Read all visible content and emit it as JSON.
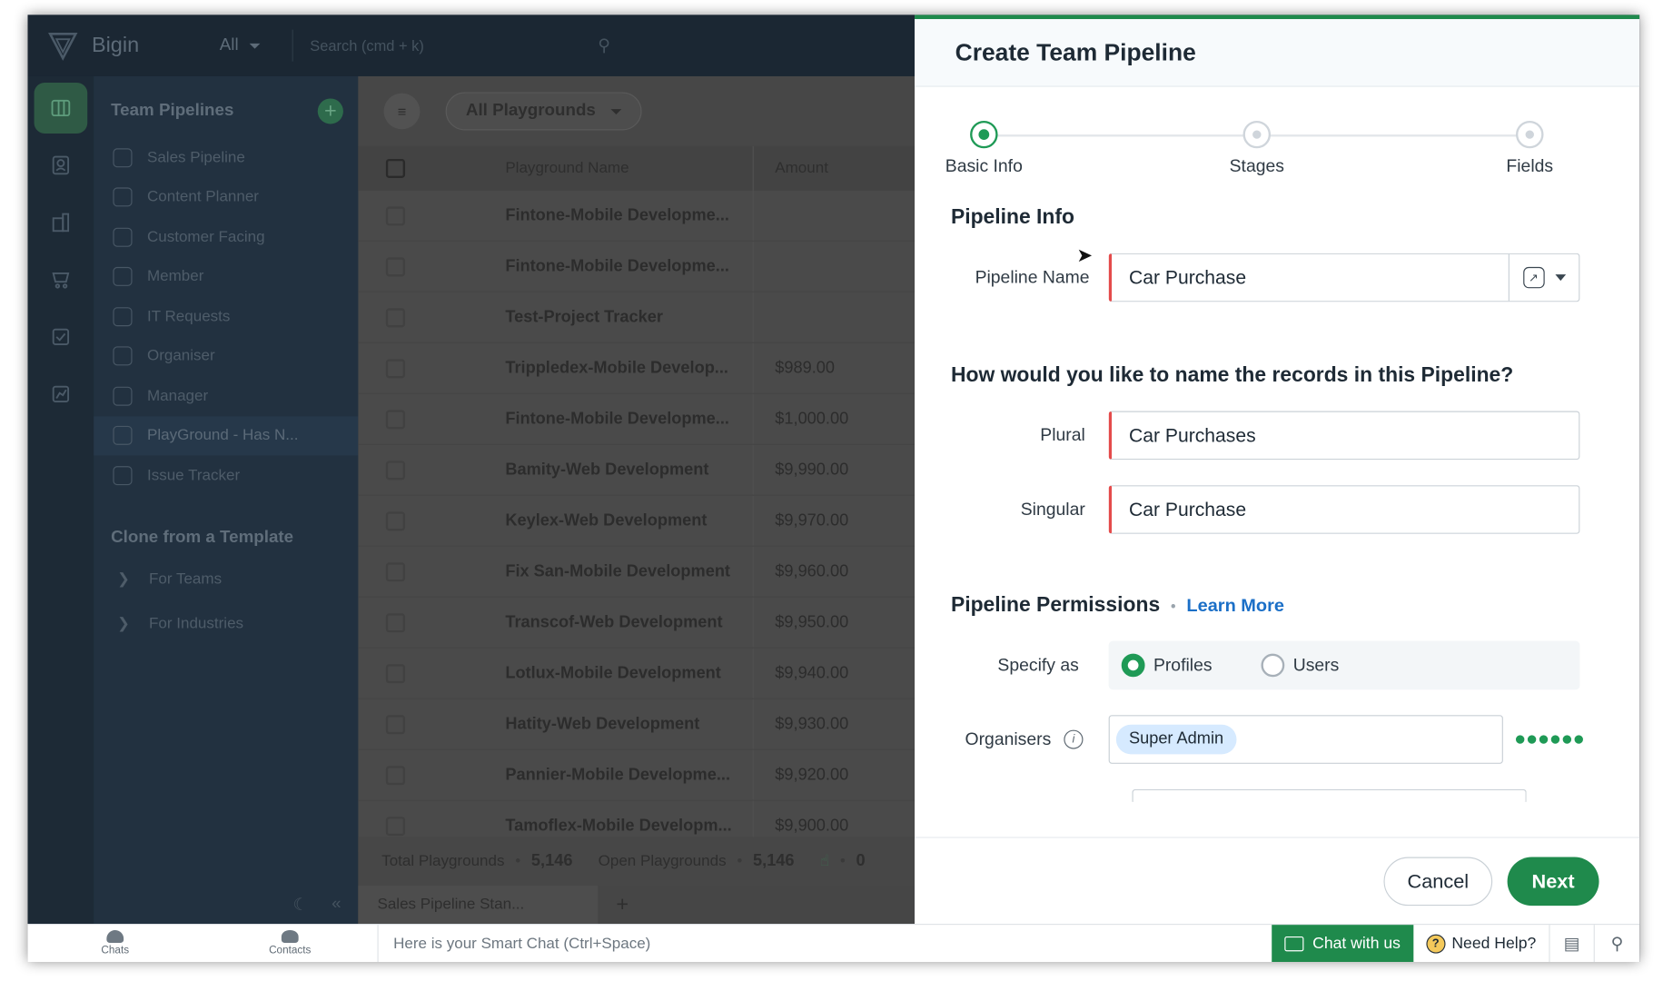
{
  "app": {
    "name": "Bigin"
  },
  "topbar": {
    "filter_label": "All",
    "search_placeholder": "Search (cmd + k)"
  },
  "rail": {
    "icons": [
      "pipeline-icon",
      "contacts-icon",
      "companies-icon",
      "products-icon",
      "tasks-icon",
      "reports-icon"
    ]
  },
  "sidebar": {
    "section_title": "Team Pipelines",
    "items": [
      {
        "label": "Sales Pipeline"
      },
      {
        "label": "Content Planner"
      },
      {
        "label": "Customer Facing"
      },
      {
        "label": "Member"
      },
      {
        "label": "IT Requests"
      },
      {
        "label": "Organiser"
      },
      {
        "label": "Manager"
      },
      {
        "label": "PlayGround - Has N..."
      },
      {
        "label": "Issue Tracker"
      }
    ],
    "clone_title": "Clone from a Template",
    "clone_items": [
      {
        "label": "For Teams"
      },
      {
        "label": "For Industries"
      }
    ]
  },
  "main": {
    "select_label": "All Playgrounds",
    "columns": {
      "name": "Playground Name",
      "amount": "Amount"
    },
    "rows": [
      {
        "name": "Fintone-Mobile Developme...",
        "amount": ""
      },
      {
        "name": "Fintone-Mobile Developme...",
        "amount": ""
      },
      {
        "name": "Test-Project Tracker",
        "amount": ""
      },
      {
        "name": "Trippledex-Mobile Develop...",
        "amount": "$989.00"
      },
      {
        "name": "Fintone-Mobile Developme...",
        "amount": "$1,000.00"
      },
      {
        "name": "Bamity-Web Development",
        "amount": "$9,990.00"
      },
      {
        "name": "Keylex-Web Development",
        "amount": "$9,970.00"
      },
      {
        "name": "Fix San-Mobile Development",
        "amount": "$9,960.00"
      },
      {
        "name": "Transcof-Web Development",
        "amount": "$9,950.00"
      },
      {
        "name": "Lotlux-Mobile Development",
        "amount": "$9,940.00"
      },
      {
        "name": "Hatity-Web Development",
        "amount": "$9,930.00"
      },
      {
        "name": "Pannier-Mobile Developme...",
        "amount": "$9,920.00"
      },
      {
        "name": "Tamoflex-Mobile Developm...",
        "amount": "$9,900.00"
      }
    ],
    "footer": {
      "total_label": "Total Playgrounds",
      "total_value": "5,146",
      "open_label": "Open Playgrounds",
      "open_value": "5,146",
      "won_value": "0"
    },
    "tab_label": "Sales Pipeline Stan..."
  },
  "panel": {
    "title": "Create Team Pipeline",
    "steps": [
      {
        "label": "Basic Info"
      },
      {
        "label": "Stages"
      },
      {
        "label": "Fields"
      }
    ],
    "pipeline_info_title": "Pipeline Info",
    "pipeline_name_label": "Pipeline Name",
    "pipeline_name_value": "Car Purchase",
    "records_question": "How would you like to name the records in this Pipeline?",
    "plural_label": "Plural",
    "plural_value": "Car Purchases",
    "singular_label": "Singular",
    "singular_value": "Car Purchase",
    "permissions_title": "Pipeline Permissions",
    "learn_more": "Learn More",
    "specify_label": "Specify as",
    "radio_profiles": "Profiles",
    "radio_users": "Users",
    "organisers_label": "Organisers",
    "organisers_chip": "Super Admin",
    "cancel_label": "Cancel",
    "next_label": "Next"
  },
  "bottombar": {
    "chats_label": "Chats",
    "contacts_label": "Contacts",
    "smart_chat_placeholder": "Here is your Smart Chat (Ctrl+Space)",
    "chat_with_us": "Chat with us",
    "need_help": "Need Help?"
  },
  "colors": {
    "accent": "#1f8a4c",
    "link": "#1b6fc7",
    "required": "#e44b4b"
  }
}
